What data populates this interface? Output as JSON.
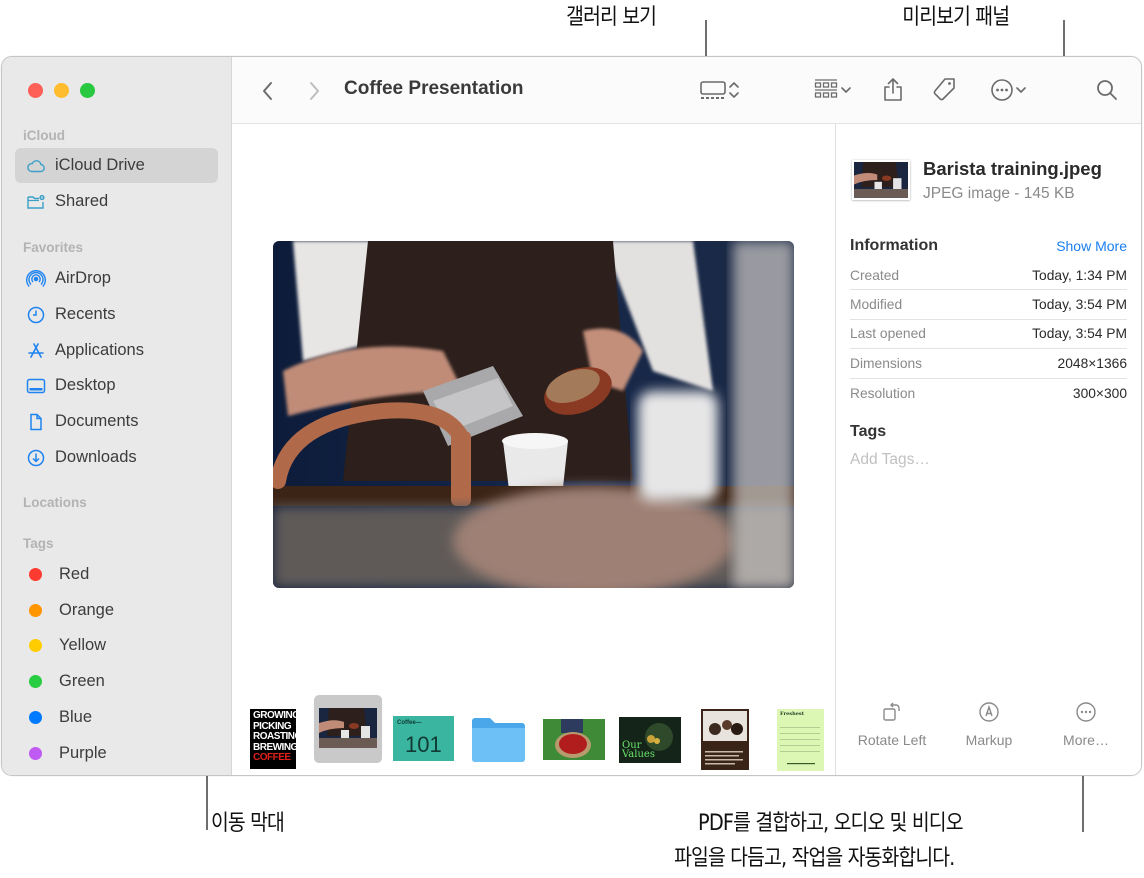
{
  "callouts": {
    "gallery_view": "갤러리 보기",
    "preview_pane": "미리보기 패널",
    "scroll_bar": "이동 막대",
    "more_line1": "PDF를 결합하고, 오디오 및 비디오",
    "more_line2": "파일을 다듬고, 작업을 자동화합니다."
  },
  "sidebar": {
    "sections": {
      "icloud": "iCloud",
      "favorites": "Favorites",
      "locations": "Locations",
      "tags": "Tags"
    },
    "icloud_items": [
      {
        "label": "iCloud Drive",
        "icon": "cloud-icon",
        "selected": true
      },
      {
        "label": "Shared",
        "icon": "shared-folder-icon",
        "selected": false
      }
    ],
    "favorites": [
      {
        "label": "AirDrop",
        "icon": "airdrop-icon"
      },
      {
        "label": "Recents",
        "icon": "clock-icon"
      },
      {
        "label": "Applications",
        "icon": "applications-icon"
      },
      {
        "label": "Desktop",
        "icon": "desktop-icon"
      },
      {
        "label": "Documents",
        "icon": "document-icon"
      },
      {
        "label": "Downloads",
        "icon": "download-icon"
      }
    ],
    "tags": [
      {
        "label": "Red",
        "color": "#fe3b30"
      },
      {
        "label": "Orange",
        "color": "#ff9500"
      },
      {
        "label": "Yellow",
        "color": "#ffcc00"
      },
      {
        "label": "Green",
        "color": "#28cd41"
      },
      {
        "label": "Blue",
        "color": "#007aff"
      },
      {
        "label": "Purple",
        "color": "#bf5af2"
      }
    ]
  },
  "toolbar": {
    "title": "Coffee Presentation",
    "icons": [
      "back-icon",
      "forward-icon",
      "gallery-view-icon",
      "group-icon",
      "share-icon",
      "tag-icon",
      "more-actions-icon",
      "search-icon"
    ]
  },
  "gallery": {
    "selected_index": 1,
    "thumbnails": [
      {
        "name": "growing-picking-poster",
        "lines": [
          "GROWING",
          "PICKING",
          "ROASTING",
          "BREWING"
        ],
        "accent_line": "COFFEE"
      },
      {
        "name": "barista-training-photo"
      },
      {
        "name": "coffee-101-doc",
        "label_small": "Coffee—",
        "label_big": "101"
      },
      {
        "name": "folder"
      },
      {
        "name": "coffee-cherries-photo"
      },
      {
        "name": "our-values-doc",
        "label": "Our Values"
      },
      {
        "name": "cafe-people-doc"
      },
      {
        "name": "order-form-doc",
        "label": "Freshest"
      }
    ]
  },
  "preview": {
    "file_name": "Barista training.jpeg",
    "file_kind": "JPEG image - 145 KB",
    "info_title": "Information",
    "show_more": "Show More",
    "rows": [
      {
        "key": "Created",
        "value": "Today, 1:34 PM"
      },
      {
        "key": "Modified",
        "value": "Today, 3:54 PM"
      },
      {
        "key": "Last opened",
        "value": "Today, 3:54 PM"
      },
      {
        "key": "Dimensions",
        "value": "2048×1366"
      },
      {
        "key": "Resolution",
        "value": "300×300"
      }
    ],
    "tags_title": "Tags",
    "tags_placeholder": "Add Tags…",
    "actions": [
      {
        "label": "Rotate Left",
        "icon": "rotate-left-icon"
      },
      {
        "label": "Markup",
        "icon": "markup-icon"
      },
      {
        "label": "More…",
        "icon": "more-icon"
      }
    ]
  }
}
